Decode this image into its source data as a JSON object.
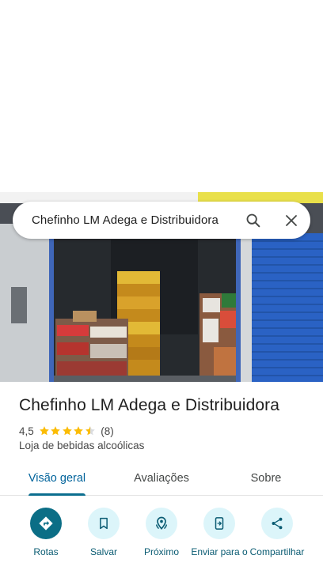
{
  "search": {
    "query": "Chefinho LM Adega e Distribuidora"
  },
  "place": {
    "name": "Chefinho LM Adega e Distribuidora",
    "rating": "4,5",
    "stars": 4.5,
    "review_count": "(8)",
    "category": "Loja de bebidas alcoólicas"
  },
  "tabs": [
    {
      "label": "Visão geral",
      "active": true
    },
    {
      "label": "Avaliações",
      "active": false
    },
    {
      "label": "Sobre",
      "active": false
    }
  ],
  "actions": [
    {
      "label": "Rotas",
      "icon": "directions-icon"
    },
    {
      "label": "Salvar",
      "icon": "bookmark-icon"
    },
    {
      "label": "Próximo",
      "icon": "nearby-icon"
    },
    {
      "label": "Enviar para o",
      "icon": "send-to-phone-icon"
    },
    {
      "label": "Compartilhar",
      "icon": "share-icon"
    }
  ],
  "colors": {
    "accent": "#0b6e86",
    "action_bg": "#dcf5fa",
    "star": "#fbbc04",
    "tab_active": "#00639b"
  }
}
